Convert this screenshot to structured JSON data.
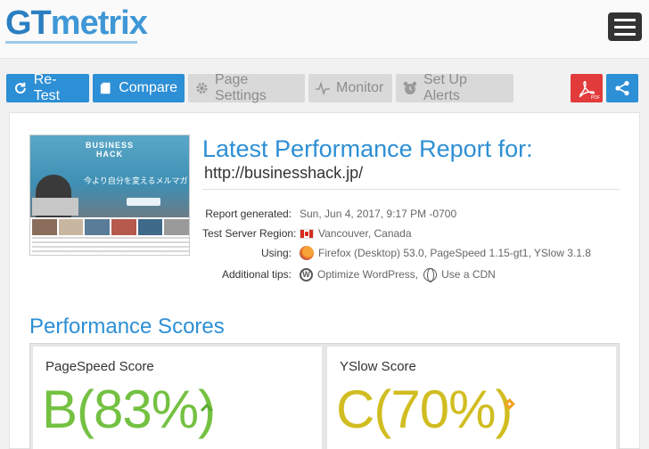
{
  "header": {
    "logo_gt": "GT",
    "logo_metrix": "metrix"
  },
  "toolbar": {
    "retest_label": "Re-Test",
    "compare_label": "Compare",
    "page_settings_label": "Page Settings",
    "monitor_label": "Monitor",
    "alerts_label": "Set Up Alerts",
    "pdf_label": "PDF"
  },
  "report": {
    "title": "Latest Performance Report for:",
    "url": "http://businesshack.jp/",
    "meta": [
      {
        "key": "Report generated:",
        "value": "Sun, Jun 4, 2017, 9:17 PM -0700"
      },
      {
        "key": "Test Server Region:",
        "value": "Vancouver, Canada"
      },
      {
        "key": "Using:",
        "value": "Firefox (Desktop) 53.0, PageSpeed 1.15-gt1, YSlow 3.1.8"
      },
      {
        "key": "Additional tips:",
        "value": "Optimize WordPress,",
        "value2": "Use a CDN"
      }
    ],
    "thumbnail": {
      "brand_line1": "BUSINESS",
      "brand_line2": "HACK",
      "jp_text": "今より自分を変えるメルマガ"
    }
  },
  "scores": {
    "section_title": "Performance Scores",
    "pagespeed": {
      "label": "PageSpeed Score",
      "grade": "B",
      "percent_text": "(83%)",
      "percent": 83,
      "trend": "up"
    },
    "yslow": {
      "label": "YSlow Score",
      "grade": "C",
      "percent_text": "(70%)",
      "percent": 70,
      "trend": "same"
    }
  },
  "colors": {
    "accent": "#2d8fd5",
    "grade_b": "#74c142",
    "grade_c": "#d1bd21",
    "pdf": "#e23b3b",
    "disabled_button": "#d9d9d9"
  },
  "icons": {
    "retest": "refresh-icon",
    "compare": "document-icon",
    "page_settings": "gear-icon",
    "monitor": "pulse-icon",
    "alerts": "alarm-clock-icon",
    "pdf": "pdf-icon",
    "share": "share-icon",
    "menu": "hamburger-menu-icon"
  }
}
